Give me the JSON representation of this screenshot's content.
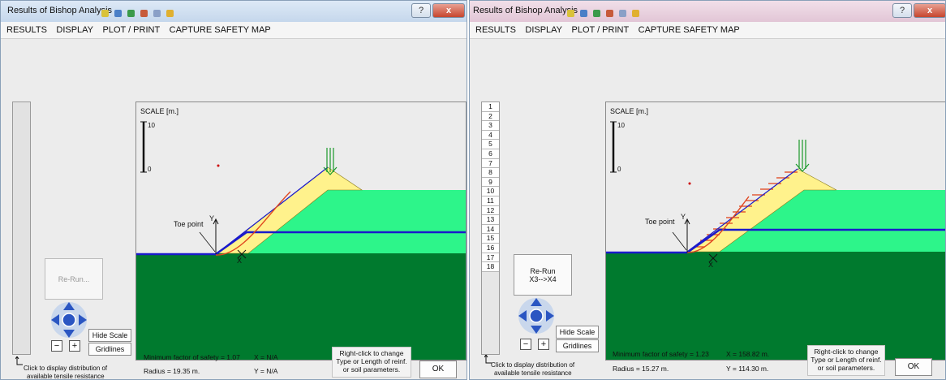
{
  "windows": [
    {
      "title": "Results of Bishop Analysis",
      "menu": [
        "RESULTS",
        "DISPLAY",
        "PLOT / PRINT",
        "CAPTURE SAFETY MAP"
      ],
      "help_label": "?",
      "close_label": "x",
      "scale_label": "SCALE [m.]",
      "scale_top": "10",
      "scale_bottom": "0",
      "toe_label": "Toe point",
      "y_label": "Y",
      "x_label": "X",
      "rerun_line1": "Re-Run...",
      "rerun_line2": "",
      "hide_scale_label": "Hide Scale",
      "gridlines_label": "Gridlines",
      "hint_line1": "Click to display distribution of",
      "hint_line2": "available tensile resistance",
      "min_fs": "Minimum factor of safety = 1.07",
      "radius": "Radius = 19.35 m.",
      "x_val": "X = N/A",
      "y_val": "Y = N/A",
      "note_line1": "Right-click to change",
      "note_line2": "Type or Length of reinf.",
      "note_line3": "or soil parameters.",
      "ok_label": "OK"
    },
    {
      "title": "Results of Bishop Analysis",
      "menu": [
        "RESULTS",
        "DISPLAY",
        "PLOT / PRINT",
        "CAPTURE SAFETY MAP"
      ],
      "help_label": "?",
      "close_label": "x",
      "reinforcement_layers": [
        "1",
        "2",
        "3",
        "4",
        "5",
        "6",
        "7",
        "8",
        "9",
        "10",
        "11",
        "12",
        "13",
        "14",
        "15",
        "16",
        "17",
        "18"
      ],
      "scale_label": "SCALE [m.]",
      "scale_top": "10",
      "scale_bottom": "0",
      "toe_label": "Toe point",
      "y_label": "Y",
      "x_label": "X",
      "rerun_line1": "Re-Run",
      "rerun_line2": "X3-->X4",
      "hide_scale_label": "Hide Scale",
      "gridlines_label": "Gridlines",
      "hint_line1": "Click to display distribution of",
      "hint_line2": "available tensile resistance",
      "min_fs": "Minimum factor of safety = 1.23",
      "radius": "Radius = 15.27 m.",
      "x_val": "X = 158.82 m.",
      "y_val": "Y = 114.30 m.",
      "note_line1": "Right-click to change",
      "note_line2": "Type or Length of reinf.",
      "note_line3": "or soil parameters.",
      "ok_label": "OK"
    }
  ],
  "colors": {
    "foundation": "#007a2e",
    "upper_soil": "#2df58a",
    "fill_slope": "#fff28c",
    "water_line": "#1a1acc",
    "slip_surface": "#e0461f",
    "load_arrow": "#1a9a2a"
  }
}
